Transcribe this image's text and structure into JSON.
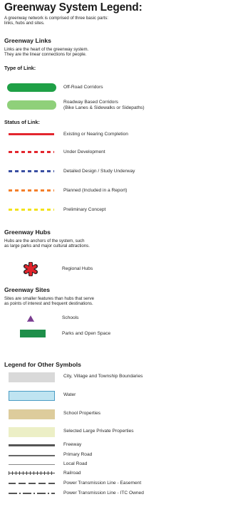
{
  "title": "Greenway System Legend:",
  "intro": [
    "A greenway network is comprised of three basic parts:",
    "links, hubs and sites."
  ],
  "links": {
    "heading": "Greenway Links",
    "desc": [
      "Links are the heart of the greenway system.",
      "They are the linear connections for people."
    ],
    "type_heading": "Type of Link:",
    "types": [
      {
        "label": [
          "Off-Road Corridors"
        ],
        "color": "#1fa046"
      },
      {
        "label": [
          "Roadway Based Corridors",
          "(Bike Lanes & Sidewalks or Sidepaths)"
        ],
        "color": "#8fd07a"
      }
    ],
    "status_heading": "Status of Link:",
    "statuses": [
      {
        "label": "Existing or Nearing Completion",
        "color": "#e3262e",
        "style": "solid"
      },
      {
        "label": "Under Development",
        "color": "#e3262e",
        "style": "dashed"
      },
      {
        "label": "Detailed Design / Study Underway",
        "color": "#3a4fa2",
        "style": "dashed"
      },
      {
        "label": "Planned (Included in a Report)",
        "color": "#f47f2a",
        "style": "dashed"
      },
      {
        "label": "Preliminary Concept",
        "color": "#f2e21a",
        "style": "dashed"
      }
    ]
  },
  "hubs": {
    "heading": "Greenway Hubs",
    "desc": [
      "Hubs are the anchors of the system, such",
      "as large parks and major cultural attractions."
    ],
    "items": [
      {
        "label": "Regional Hubs",
        "icon": "red-asterisk-icon",
        "color": "#e0242c"
      }
    ]
  },
  "sites": {
    "heading": "Greenway Sites",
    "desc": [
      "Sites are smaller features than hubs that serve",
      "as points of interest and frequent destinations."
    ],
    "items": [
      {
        "label": "Schools",
        "icon": "school-triangle-icon",
        "color": "#7a3d8f"
      },
      {
        "label": "Parks and Open Space",
        "icon": "park-square-icon",
        "color": "#1e8f4a"
      }
    ]
  },
  "other": {
    "heading": "Legend for Other Symbols",
    "areas": [
      {
        "label": "City, Village and Township Boundaries",
        "color": "#d9d9d9"
      },
      {
        "label": "Water",
        "color": "#bfe4f1"
      },
      {
        "label": "School Properties",
        "color": "#ddcc9c"
      },
      {
        "label": "Selected Large Private Properties",
        "color": "#ecefc6"
      }
    ],
    "lines": [
      {
        "label": "Freeway",
        "color": "#555555",
        "style": "thick"
      },
      {
        "label": "Primary Road",
        "color": "#666666",
        "style": "medium"
      },
      {
        "label": "Local Road",
        "color": "#888888",
        "style": "thin"
      },
      {
        "label": "Railroad",
        "color": "#444444",
        "style": "rail"
      },
      {
        "label": "Power Transmission Line - Easement",
        "color": "#555555",
        "style": "power-dash"
      },
      {
        "label": "Power Transmission Line - ITC Owned",
        "color": "#555555",
        "style": "power-dashdot"
      }
    ]
  }
}
